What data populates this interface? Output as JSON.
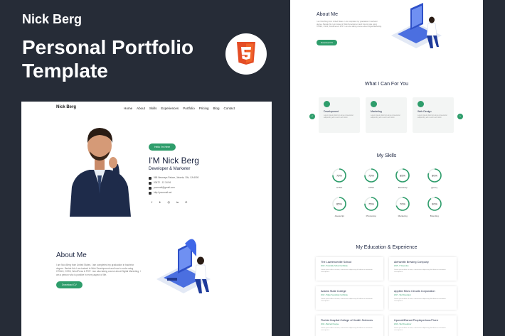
{
  "promo": {
    "brand": "Nick Berg",
    "headline": "Personal Portfolio Template",
    "badge_icon": "html5-icon",
    "accent": "#2e9d6b",
    "background": "#262c37"
  },
  "left_page": {
    "logo": "Nick Berg",
    "menu": [
      "Home",
      "About",
      "Skills",
      "Experiences",
      "Portfolio",
      "Pricing",
      "Blog",
      "Contact"
    ],
    "hello_label": "Hello I'm Here",
    "name": "I'M Nick Berg",
    "role": "Developer & Marketer",
    "contacts": [
      "568 Newnaps Palace, Jakarta, 10b, CA 6000",
      "00672 - 12 34 56",
      "yourmail@gmail.com",
      "http://yourmail.net"
    ],
    "social_icons": [
      "facebook-icon",
      "twitter-icon",
      "instagram-icon",
      "linkedin-icon",
      "skype-icon"
    ],
    "about": {
      "title": "About Me",
      "text": "I am Nick Berg from United States. I am completed my graduation in bachelor degree. Beside this I am trained in Web Development and how to code using HTML5, CSS3, WordPress & PHP. I am also taking course about Digital Marketing. I am a person who is positive in every aspect of life.",
      "button": "Download CV"
    }
  },
  "right_page": {
    "about": {
      "title": "About Me",
      "text": "I am Nick Berg from United States. I am completed my graduation in bachelor degree. Beside this I am trained in Web Development and how to code using HTML5, CSS3, WordPress & PHP. I am also taking course about Digital Marketing.",
      "button": "Download CV"
    },
    "services_title": "What I Can For You",
    "services": [
      {
        "title": "Development",
        "text": "Lorem ipsum dolor sit amet consectetur adipisicing elit ut enim ad minim",
        "icon": "gear-icon"
      },
      {
        "title": "Marketing",
        "text": "Lorem ipsum dolor sit amet consectetur adipisicing elit ut enim ad minim",
        "icon": "chart-icon"
      },
      {
        "title": "Web Design",
        "text": "Lorem ipsum dolor sit amet consectetur adipisicing elit ut enim ad minim",
        "icon": "design-icon"
      }
    ],
    "skills_title": "My Skills",
    "skills": [
      {
        "label": "HTML",
        "value": 75
      },
      {
        "label": "CSS3",
        "value": 75
      },
      {
        "label": "Bootstrap",
        "value": 85
      },
      {
        "label": "jQuery",
        "value": 80
      },
      {
        "label": "Javascript",
        "value": 65
      },
      {
        "label": "Photoshop",
        "value": 75
      },
      {
        "label": "Marketing",
        "value": 70
      },
      {
        "label": "Branding",
        "value": 90
      }
    ],
    "education_title": "My Education & Experience",
    "education": [
      {
        "title": "The Lawrenceville School",
        "sub": "2010 - Honorable School Certificate",
        "text": "Lorem ipsum dolor sit amet, consectetur adipisicing elit labore accusantium consequatur."
      },
      {
        "title": "Alehsmith Brewing Company",
        "sub": "2015 - IT Executive",
        "text": "Lorem ipsum dolor sit amet, consectetur adipisicing elit labore accusantium consequatur."
      },
      {
        "title": "Adams State College",
        "sub": "2012 - Higher Secondary Certificate",
        "text": "Lorem ipsum dolor sit amet, consectetur adipisicing elit labore accusantium consequatur."
      },
      {
        "title": "Applied Micro Circuits Corporation",
        "sub": "2017 - Web Developer",
        "text": "Lorem ipsum dolor sit amet, consectetur adipisicing elit labore accusantium consequatur."
      },
      {
        "title": "Florida Hospital College of Health Sciences",
        "sub": "2014 - Bachelor Degree",
        "text": "Lorem ipsum dolor sit amet, consectetur adipisicing elit labore accusantium consequatur."
      },
      {
        "title": "Upwork/Elance/Peopleperhour/Fiverr",
        "sub": "2019 - Web Freelancer",
        "text": "Lorem ipsum dolor sit amet, consectetur adipisicing elit labore accusantium consequatur."
      }
    ]
  }
}
